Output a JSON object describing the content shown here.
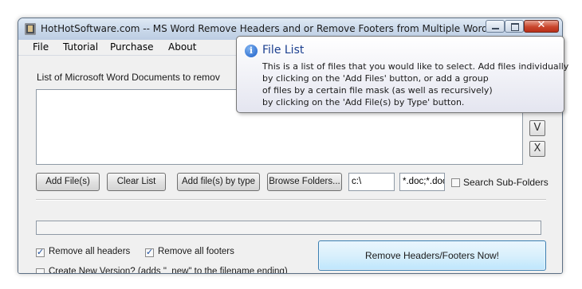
{
  "window": {
    "title": "HotHotSoftware.com -- MS Word Remove Headers and or Remove Footers from Multiple Word Docu...",
    "close_glyph": "✕"
  },
  "menu": [
    "File",
    "Tutorial",
    "Purchase",
    "About"
  ],
  "list_label": "List of Microsoft Word Documents to remov",
  "side_buttons": {
    "down": "V",
    "remove": "X"
  },
  "buttons": {
    "add_files": "Add File(s)",
    "clear_list": "Clear List",
    "add_by_type": "Add file(s) by type",
    "browse_folders": "Browse Folders..."
  },
  "inputs": {
    "folder": "c:\\",
    "mask": "*.doc;*.doc"
  },
  "search_subfolders": {
    "label": "Search Sub-Folders",
    "checked": false
  },
  "progress": {
    "fraction": 0.0
  },
  "options": {
    "remove_headers": {
      "label": "Remove all headers",
      "checked": true
    },
    "remove_footers": {
      "label": "Remove all footers",
      "checked": true
    },
    "new_version": {
      "label": "Create New Version? (adds \"_new\" to the filename ending)",
      "checked": false
    }
  },
  "action_button": "Remove Headers/Footers Now!",
  "tooltip": {
    "icon": "info-icon",
    "title": "File List",
    "lines": [
      "This is a list of files that you would like to select. Add files individually",
      "by clicking on the 'Add Files' button, or add a group",
      "of files by a certain file mask (as well as recursively)",
      "by clicking on the 'Add File(s) by Type' button."
    ]
  }
}
